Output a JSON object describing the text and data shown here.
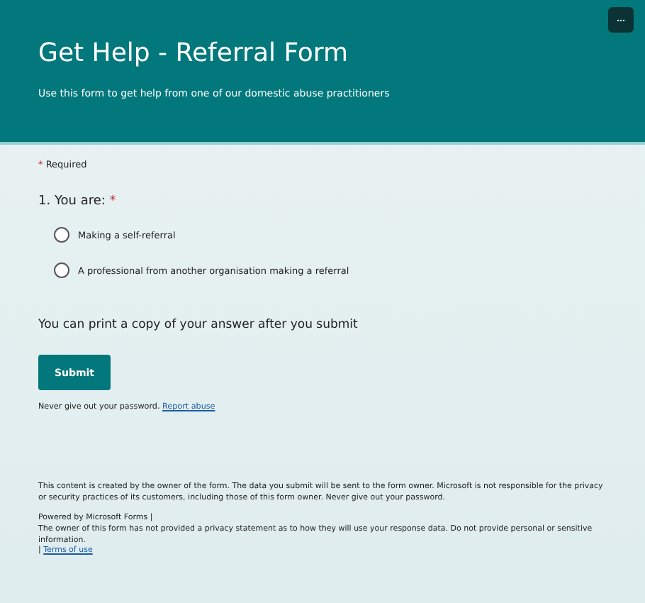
{
  "header": {
    "menu_button": "...",
    "title": "Get Help - Referral Form",
    "description": "Use this form to get help from one of our domestic abuse practitioners"
  },
  "required_note": {
    "mark": "*",
    "label": "Required"
  },
  "question": {
    "label": "1. You are:",
    "required_mark": "*",
    "options": [
      {
        "label": "Making a self-referral",
        "selected": false
      },
      {
        "label": "A professional from another organisation making a referral",
        "selected": false
      }
    ]
  },
  "print_note": "You can print a copy of your answer after you submit",
  "submit_button": "Submit",
  "password_note": "Never give out your password.",
  "report_link": "Report abuse",
  "footer": {
    "disclaimer": "This content is created by the owner of the form. The data you submit will be sent to the form owner. Microsoft is not responsible for the privacy or security practices of its customers, including those of this form owner. Never give out your password.",
    "powered_by": "Powered by Microsoft Forms |",
    "privacy": "The owner of this form has not provided a privacy statement as to how they will use your response data. Do not provide personal or sensitive information.",
    "separator": "|",
    "terms_link": "Terms of use"
  }
}
